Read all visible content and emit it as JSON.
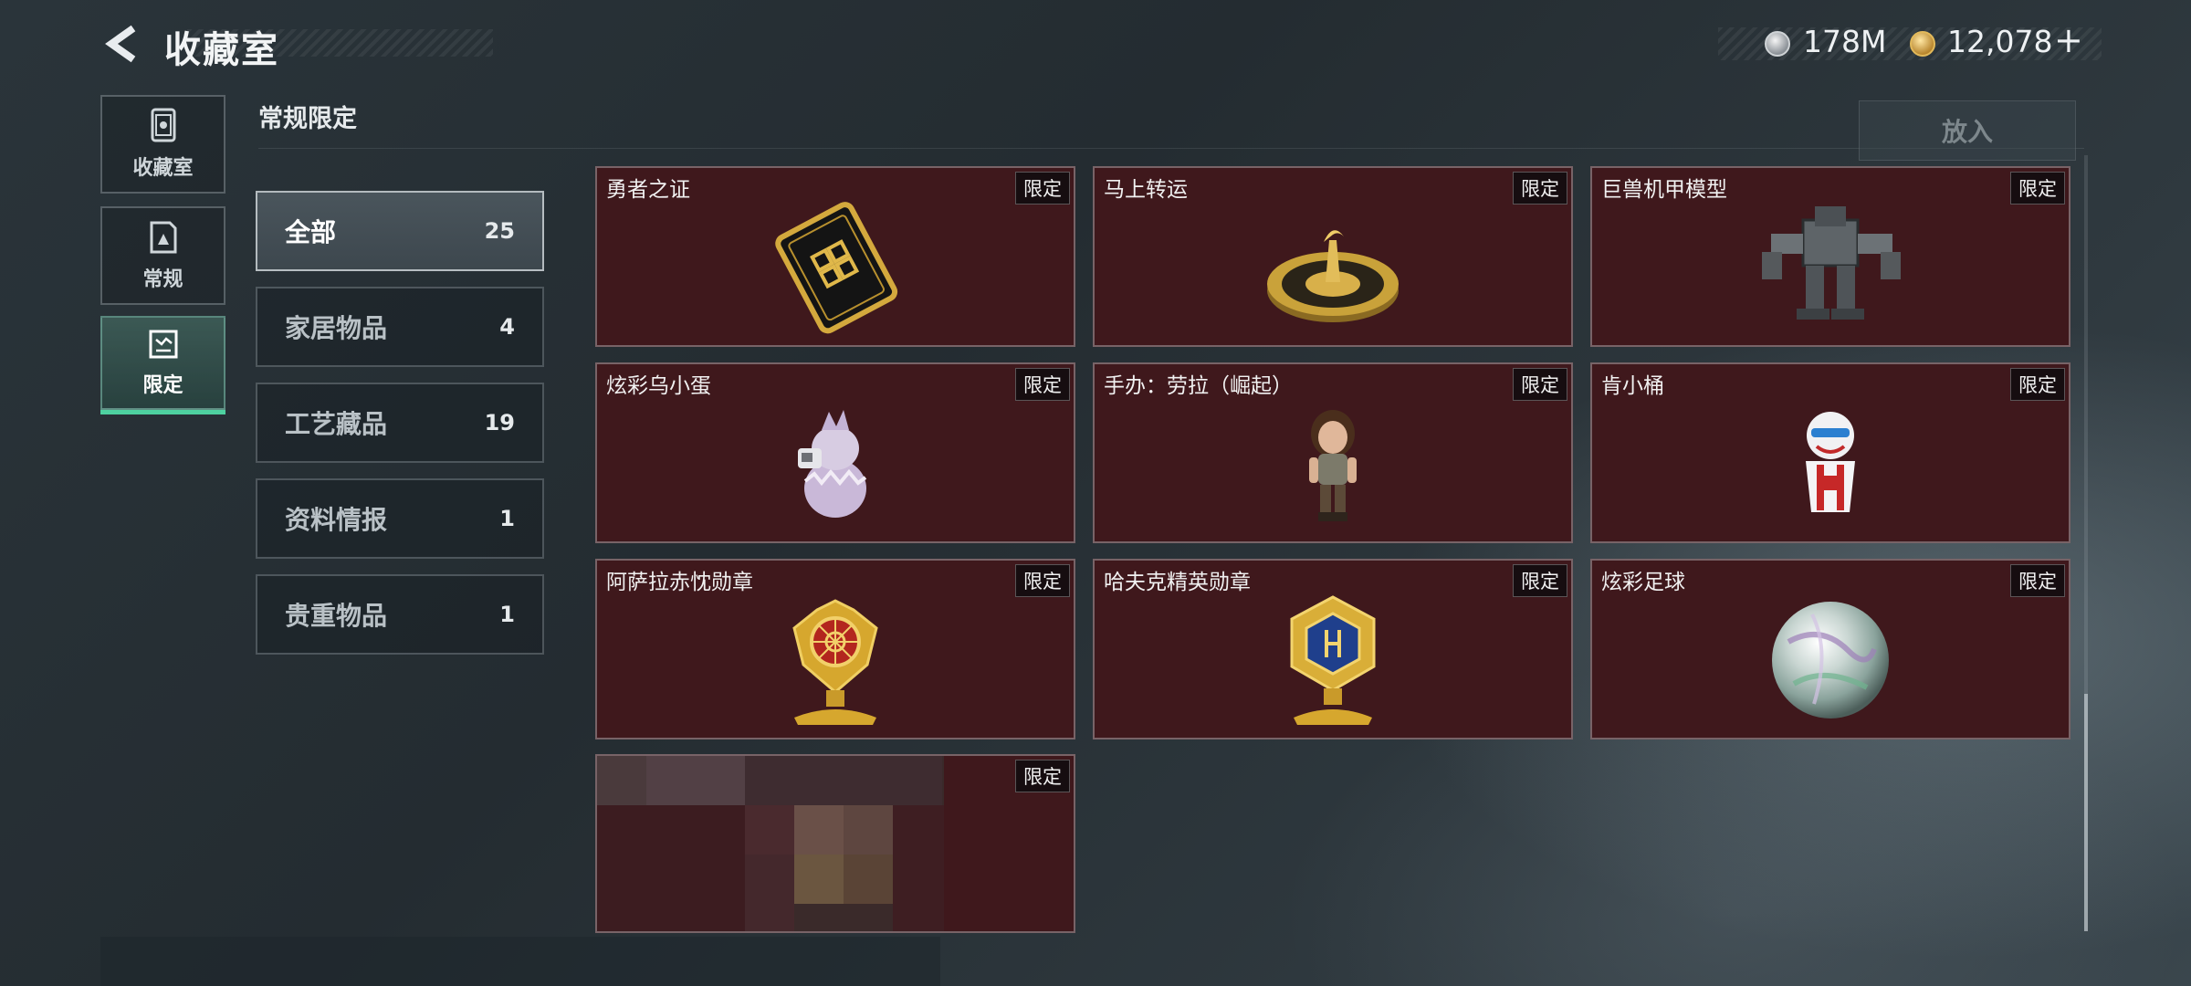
{
  "header": {
    "title": "收藏室",
    "currencies": [
      {
        "icon": "silver-coin-icon",
        "amount": "178M"
      },
      {
        "icon": "gold-coin-icon",
        "amount": "12,078"
      }
    ],
    "add_symbol": "+"
  },
  "nav": [
    {
      "label": "收藏室",
      "icon": "collection-room-icon"
    },
    {
      "label": "常规",
      "icon": "regular-icon"
    },
    {
      "label": "限定",
      "icon": "limited-icon",
      "active": true
    }
  ],
  "section_title": "常规限定",
  "categories": [
    {
      "label": "全部",
      "count": "25",
      "active": true
    },
    {
      "label": "家居物品",
      "count": "4"
    },
    {
      "label": "工艺藏品",
      "count": "19"
    },
    {
      "label": "资料情报",
      "count": "1"
    },
    {
      "label": "贵重物品",
      "count": "1"
    }
  ],
  "put_in_button": "放入",
  "badge_label": "限定",
  "items": [
    {
      "name": "勇者之证",
      "icon": "hero-card-icon"
    },
    {
      "name": "马上转运",
      "icon": "golden-turntable-icon"
    },
    {
      "name": "巨兽机甲模型",
      "icon": "mech-model-icon"
    },
    {
      "name": "炫彩乌小蛋",
      "icon": "egg-figure-icon"
    },
    {
      "name": "手办：劳拉（崛起）",
      "icon": "lara-figure-icon"
    },
    {
      "name": "肯小桶",
      "icon": "bucket-figure-icon"
    },
    {
      "name": "阿萨拉赤忱勋章",
      "icon": "red-medal-icon"
    },
    {
      "name": "哈夫克精英勋章",
      "icon": "blue-medal-icon"
    },
    {
      "name": "炫彩足球",
      "icon": "iridescent-ball-icon"
    },
    {
      "name": "",
      "icon": "blurred-item-icon"
    }
  ],
  "colors": {
    "card_bg": "#3f181c",
    "active_accent": "#4ed1a0",
    "gold": "#c9a23a"
  }
}
